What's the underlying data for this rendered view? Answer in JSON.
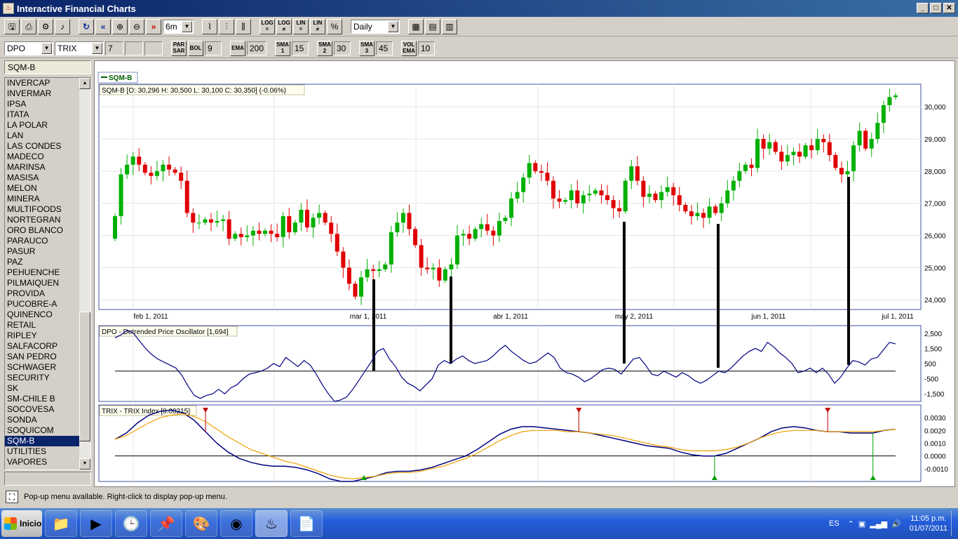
{
  "window": {
    "title": "Interactive Financial Charts",
    "controls": [
      "_",
      "□",
      "✕"
    ]
  },
  "toolbar1": {
    "period": "6m",
    "interval": "Daily",
    "log1_top": "LOG",
    "log1_bot": "=",
    "log2_top": "LOG",
    "log2_bot": "≠",
    "lin1_top": "LIN",
    "lin1_bot": "=",
    "lin2_top": "LIN",
    "lin2_bot": "≠",
    "pct": "%"
  },
  "toolbar2": {
    "indicator1": "DPO",
    "indicator2": "TRIX",
    "param1": "7",
    "param2": "",
    "param3": "",
    "par_top": "PAR",
    "par_bot": "SAR",
    "bol_label": "BOL",
    "bol_value": "9",
    "ema_label": "EMA",
    "ema_value": "200",
    "sma1_top": "SMA",
    "sma1_bot": "1",
    "sma1_value": "15",
    "sma2_top": "SMA",
    "sma2_bot": "2",
    "sma2_value": "30",
    "sma3_top": "SMA",
    "sma3_bot": "3",
    "sma3_value": "45",
    "vol_top": "VOL",
    "vol_bot": "EMA",
    "vol_value": "10"
  },
  "sidebar": {
    "header": "SQM-B",
    "selected": "SQM-B",
    "items": [
      "INVERCAP",
      "INVERMAR",
      "IPSA",
      "ITATA",
      "LA POLAR",
      "LAN",
      "LAS CONDES",
      "MADECO",
      "MARINSA",
      "MASISA",
      "MELON",
      "MINERA",
      "MULTIFOODS",
      "NORTEGRAN",
      "ORO BLANCO",
      "PARAUCO",
      "PASUR",
      "PAZ",
      "PEHUENCHE",
      "PILMAIQUEN",
      "PROVIDA",
      "PUCOBRE-A",
      "QUINENCO",
      "RETAIL",
      "RIPLEY",
      "SALFACORP",
      "SAN PEDRO",
      "SCHWAGER",
      "SECURITY",
      "SK",
      "SM-CHILE B",
      "SOCOVESA",
      "SONDA",
      "SOQUICOM",
      "SQM-B",
      "UTILITIES",
      "VAPORES"
    ]
  },
  "chart_data": [
    {
      "type": "candlestick",
      "legend": "SQM-B",
      "title": "SQM-B [O: 30,296  H: 30,500  L: 30,100  C: 30,350] (-0.06%)",
      "x_ticks": [
        "feb 1, 2011",
        "mar 1, 2011",
        "abr 1, 2011",
        "may 2, 2011",
        "jun 1, 2011",
        "jul 1, 2011"
      ],
      "y_ticks": [
        "30,000",
        "29,000",
        "28,000",
        "27,000",
        "26,000",
        "25,000",
        "24,000"
      ],
      "ylim": [
        23700,
        30700
      ],
      "close": [
        26600,
        27900,
        28200,
        28450,
        28200,
        27950,
        27850,
        28000,
        28200,
        28050,
        27950,
        27700,
        26700,
        26400,
        26400,
        26500,
        26400,
        26450,
        26500,
        25900,
        26050,
        25950,
        26000,
        26150,
        26050,
        26150,
        26050,
        25950,
        26600,
        26100,
        26400,
        26800,
        26250,
        26550,
        26700,
        26400,
        26050,
        25500,
        25000,
        24500,
        24100,
        24700,
        24950,
        24900,
        24950,
        25100,
        26100,
        26400,
        26700,
        26200,
        25700,
        25000,
        24950,
        25000,
        24600,
        24950,
        25100,
        26000,
        26050,
        25900,
        26200,
        26350,
        26150,
        26000,
        26450,
        26550,
        27150,
        27350,
        27800,
        28250,
        28000,
        27950,
        27700,
        27150,
        27050,
        27100,
        27400,
        27000,
        27250,
        27300,
        27400,
        27250,
        27100,
        26850,
        26750,
        27700,
        28150,
        27700,
        27200,
        27300,
        27100,
        27350,
        27500,
        27250,
        26950,
        26750,
        26600,
        26700,
        26550,
        26900,
        26700,
        27000,
        27400,
        27700,
        28000,
        28200,
        28100,
        29000,
        28700,
        28900,
        28600,
        28300,
        28500,
        28600,
        28450,
        28800,
        28650,
        29000,
        28900,
        28500,
        28100,
        27900,
        28000,
        28800,
        29250,
        28700,
        29000,
        29500,
        30050,
        30300,
        30350
      ],
      "markers": [
        {
          "x": 533,
          "y_top": 398,
          "y_bot": 528
        },
        {
          "x": 643,
          "y_top": 394,
          "y_bot": 518
        },
        {
          "x": 890,
          "y_top": 316,
          "y_bot": 518
        },
        {
          "x": 1024,
          "y_top": 319,
          "y_bot": 524
        },
        {
          "x": 1210,
          "y_top": 252,
          "y_bot": 520
        }
      ]
    },
    {
      "type": "line",
      "title": "DPO - Detrended Price Oscillator [1,694]",
      "y_ticks": [
        "2,500",
        "1,500",
        "500",
        "-500",
        "-1,500"
      ],
      "ylim": [
        -2000,
        3000
      ],
      "values": [
        2200,
        2400,
        2700,
        2500,
        2000,
        1500,
        1100,
        800,
        600,
        400,
        200,
        -300,
        -1000,
        -1600,
        -1800,
        -1600,
        -1500,
        -1200,
        -1500,
        -1100,
        -900,
        -500,
        -200,
        -100,
        0,
        200,
        500,
        300,
        900,
        600,
        300,
        700,
        400,
        -200,
        -900,
        -1500,
        -2000,
        -1900,
        -1700,
        -1200,
        -600,
        0,
        600,
        1300,
        1500,
        800,
        300,
        -400,
        -800,
        -1000,
        -1300,
        -900,
        -500,
        400,
        700,
        500,
        800,
        1000,
        700,
        500,
        600,
        700,
        1000,
        1400,
        1700,
        1300,
        1000,
        700,
        500,
        600,
        900,
        1200,
        900,
        200,
        -100,
        -200,
        -400,
        -700,
        -500,
        -200,
        100,
        200,
        100,
        -200,
        300,
        800,
        900,
        400,
        -200,
        -300,
        0,
        -200,
        -400,
        -100,
        -300,
        -600,
        -800,
        -600,
        -300,
        0,
        -100,
        200,
        600,
        1000,
        1300,
        1500,
        1300,
        1900,
        1600,
        1200,
        900,
        500,
        -100,
        0,
        200,
        -100,
        200,
        -200,
        -800,
        -400,
        200,
        700,
        600,
        400,
        800,
        900,
        1400,
        1900,
        1800
      ],
      "zero": 0
    },
    {
      "type": "line",
      "title": "TRIX - TRIX Index [0.00215]",
      "y_ticks": [
        "0.0030",
        "0.0020",
        "0.0010",
        "0.0000",
        "-0.0010"
      ],
      "ylim": [
        -0.002,
        0.004
      ],
      "series": [
        {
          "color": "#000080",
          "values": [
            0.0013,
            0.0018,
            0.0026,
            0.0032,
            0.0035,
            0.0036,
            0.0034,
            0.0028,
            0.0019,
            0.001,
            0.0003,
            -0.0002,
            -0.0005,
            -0.0007,
            -0.0008,
            -0.0008,
            -0.0009,
            -0.0011,
            -0.0014,
            -0.0018,
            -0.002,
            -0.002,
            -0.0018,
            -0.0016,
            -0.0013,
            -0.0012,
            -0.0012,
            -0.0011,
            -0.0009,
            -0.0006,
            -0.0003,
            0.0,
            0.0005,
            0.0011,
            0.0017,
            0.0021,
            0.0023,
            0.0023,
            0.0022,
            0.0021,
            0.002,
            0.0019,
            0.0018,
            0.0016,
            0.0014,
            0.0012,
            0.001,
            0.0008,
            0.0007,
            0.0006,
            0.0003,
            0.0001,
            0.0,
            0.0,
            0.0002,
            0.0006,
            0.001,
            0.0014,
            0.0019,
            0.0022,
            0.0023,
            0.0022,
            0.002,
            0.0019,
            0.0019,
            0.0018,
            0.0018,
            0.0018,
            0.002,
            0.0021
          ]
        },
        {
          "color": "#f0a000",
          "values": [
            0.0013,
            0.0016,
            0.0021,
            0.0026,
            0.003,
            0.0032,
            0.0033,
            0.0031,
            0.0027,
            0.0021,
            0.0015,
            0.001,
            0.0005,
            0.0002,
            -0.0001,
            -0.0004,
            -0.0006,
            -0.0009,
            -0.0012,
            -0.0015,
            -0.0017,
            -0.0018,
            -0.0017,
            -0.0016,
            -0.0014,
            -0.0013,
            -0.0013,
            -0.0012,
            -0.001,
            -0.0008,
            -0.0005,
            -0.0002,
            0.0002,
            0.0007,
            0.0012,
            0.0016,
            0.0019,
            0.002,
            0.002,
            0.002,
            0.0019,
            0.0019,
            0.0018,
            0.0017,
            0.0016,
            0.0014,
            0.0012,
            0.001,
            0.0008,
            0.0007,
            0.0005,
            0.0004,
            0.0004,
            0.0004,
            0.0005,
            0.0007,
            0.001,
            0.0014,
            0.0017,
            0.0019,
            0.002,
            0.002,
            0.002,
            0.0019,
            0.0019,
            0.0019,
            0.0019,
            0.0019,
            0.002,
            0.0021
          ]
        }
      ],
      "zero": 0.0,
      "signals": [
        {
          "color": "#c00000",
          "dir": "down",
          "idx": 8
        },
        {
          "color": "#00a000",
          "dir": "up",
          "idx": 22
        },
        {
          "color": "#c00000",
          "dir": "down",
          "idx": 41
        },
        {
          "color": "#00a000",
          "dir": "up",
          "idx": 53
        },
        {
          "color": "#c00000",
          "dir": "down",
          "idx": 63
        },
        {
          "color": "#00a000",
          "dir": "up",
          "idx": 67
        }
      ]
    }
  ],
  "status": {
    "message": "Pop-up menu available. Right-click to display pop-up menu."
  },
  "taskbar": {
    "start": "Inicio",
    "language": "ES",
    "time": "11:05 p.m.",
    "date": "01/07/2011"
  },
  "colors": {
    "up": "#00b000",
    "down": "#e00000",
    "selected": "#0a246a",
    "title_gradient_start": "#0a246a"
  }
}
